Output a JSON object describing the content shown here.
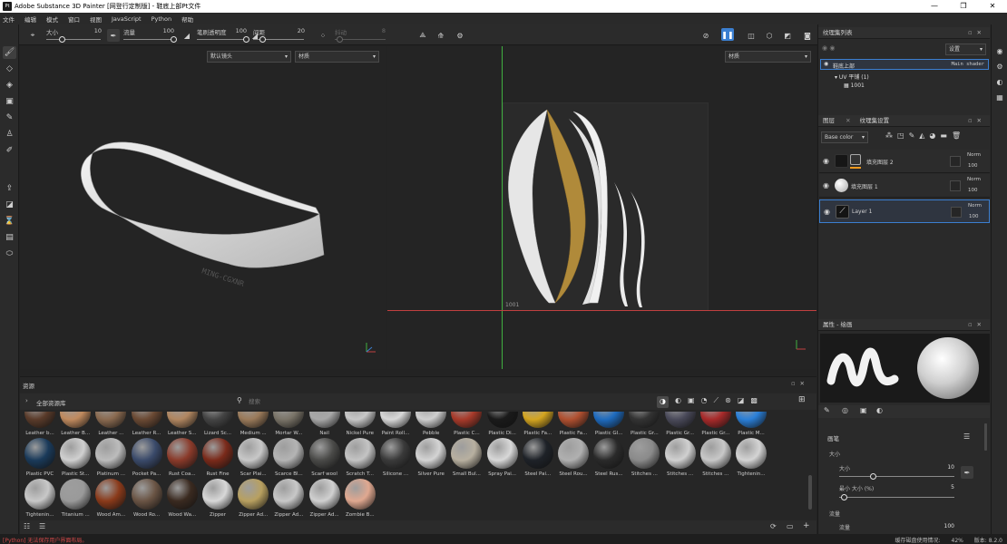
{
  "window": {
    "title": "Adobe Substance 3D Painter [网登行定制版] - 鞋底上部Pt文件",
    "logo": "Pt",
    "controls": [
      "—",
      "❐",
      "✕"
    ]
  },
  "menu": [
    "文件",
    "编辑",
    "模式",
    "窗口",
    "视图",
    "JavaScript",
    "Python",
    "帮助"
  ],
  "toolbar": {
    "size_label": "大小",
    "size_value": "10",
    "size_level": 0.3,
    "flow_label": "流量",
    "flow_value": "100",
    "flow_level": 1.0,
    "stroke_opacity_label": "笔刷透明度",
    "stroke_opacity_value": "100",
    "stroke_opacity_level": 1.0,
    "spacing_label": "间距",
    "spacing_value": "20",
    "spacing_level": 0.2,
    "jitter_label": "抖动",
    "jitter_value": "8",
    "jitter_level": 0.1
  },
  "viewport3d": {
    "camera": "默认镜头",
    "channel": "材质",
    "logo_text": "MING-CGXNR"
  },
  "viewport2d": {
    "channel": "材质",
    "uv_tile": "1001"
  },
  "texture_set_list": {
    "title": "纹理集列表",
    "settings": "设置",
    "items": [
      {
        "name": "鞋底上部",
        "shader": "Main shader"
      },
      {
        "name": "UV 平铺 (1)"
      },
      {
        "name": "1001"
      }
    ]
  },
  "layers": {
    "tab_layers": "图层",
    "tab_settings": "纹理集设置",
    "channel_select": "Base color",
    "items": [
      {
        "name": "填充图层 2",
        "blend": "Norm",
        "opacity": "100",
        "thumb": "#161616"
      },
      {
        "name": "填充图层 1",
        "blend": "Norm",
        "opacity": "100",
        "thumb": "#d8d8d8"
      },
      {
        "name": "Layer 1",
        "blend": "Norm",
        "opacity": "100",
        "thumb": "#141414"
      }
    ]
  },
  "properties": {
    "title": "属性 - 绘画",
    "section_brush": "画笔",
    "sub_size": "大小",
    "size_label": "大小",
    "size_value": "10",
    "size_level": 0.3,
    "min_size_label": "最小 大小 (%)",
    "min_size_value": "5",
    "min_size_level": 0.05,
    "section_flow": "流量",
    "flow_label": "流量",
    "flow_value": "100"
  },
  "assets": {
    "title": "资源",
    "library": "全部资源库",
    "search_placeholder": "搜索",
    "row0": [
      {
        "name": "Leather b...",
        "color": "#5a3b2a"
      },
      {
        "name": "Leather B...",
        "color": "#c08a5e"
      },
      {
        "name": "Leather ...",
        "color": "#8a6a50"
      },
      {
        "name": "Leather R...",
        "color": "#6b4a34"
      },
      {
        "name": "Leather S...",
        "color": "#b08660"
      },
      {
        "name": "Lizard Sc...",
        "color": "#444444"
      },
      {
        "name": "Medium ...",
        "color": "#9a7a5a"
      },
      {
        "name": "Mortar W...",
        "color": "#7a7468"
      },
      {
        "name": "Nail",
        "color": "#a8a8a8"
      },
      {
        "name": "Nickel Pure",
        "color": "#c8c8c8"
      },
      {
        "name": "Paint Roll...",
        "color": "#d8d8d8"
      },
      {
        "name": "Pebble",
        "color": "#cfcfcf"
      },
      {
        "name": "Plastic C...",
        "color": "#a83a2a"
      },
      {
        "name": "Plastic Di...",
        "color": "#1a1a1a"
      },
      {
        "name": "Plastic Fa...",
        "color": "#d4a520"
      },
      {
        "name": "Plastic Fa...",
        "color": "#b05030"
      },
      {
        "name": "Plastic Gl...",
        "color": "#1e6bbf"
      },
      {
        "name": "Plastic Gr...",
        "color": "#333333"
      },
      {
        "name": "Plastic Gr...",
        "color": "#4a4a5a"
      },
      {
        "name": "Plastic Gr...",
        "color": "#a82a2a"
      },
      {
        "name": "Plastic M...",
        "color": "#2a7fd8"
      }
    ],
    "row1": [
      {
        "name": "Plastic PVC",
        "color": "#1a3a5a"
      },
      {
        "name": "Plastic St...",
        "color": "#d0d0d0"
      },
      {
        "name": "Platinum ...",
        "color": "#bcbcbc"
      },
      {
        "name": "Pocket Pa...",
        "color": "#3a4a6a"
      },
      {
        "name": "Rust Coa...",
        "color": "#8a3a2a"
      },
      {
        "name": "Rust Fine",
        "color": "#7a2a1a"
      },
      {
        "name": "Scar Plai...",
        "color": "#c8c8c8"
      },
      {
        "name": "Scarce Bl...",
        "color": "#b4b4b4"
      },
      {
        "name": "Scarf wool",
        "color": "#4a4a48"
      },
      {
        "name": "Scratch T...",
        "color": "#c4c4c4"
      },
      {
        "name": "Silicone ...",
        "color": "#3a3a3a"
      },
      {
        "name": "Silver Pure",
        "color": "#d4d4d4"
      },
      {
        "name": "Small Bul...",
        "color": "#b8b0a0"
      },
      {
        "name": "Spray Pai...",
        "color": "#d8d8d8"
      },
      {
        "name": "Steel Pai...",
        "color": "#1e2228"
      },
      {
        "name": "Steel Rou...",
        "color": "#b0b0b0"
      },
      {
        "name": "Steel Rus...",
        "color": "#2a2a2a"
      },
      {
        "name": "Stitches ...",
        "color": "#8a8a8a"
      },
      {
        "name": "Stitches ...",
        "color": "#d0d0d0"
      },
      {
        "name": "Stitches ...",
        "color": "#c8c8c8"
      },
      {
        "name": "Tightenin...",
        "color": "#d4d4d4"
      }
    ],
    "row2": [
      {
        "name": "Tightenin...",
        "color": "#c8c8c8"
      },
      {
        "name": "Titanium ...",
        "color": "#9a9a9a"
      },
      {
        "name": "Wood Am...",
        "color": "#8a3a1a"
      },
      {
        "name": "Wood Ro...",
        "color": "#6a5444"
      },
      {
        "name": "Wood Wa...",
        "color": "#3a2a20"
      },
      {
        "name": "Zipper",
        "color": "#d8d8d8"
      },
      {
        "name": "Zipper Ad...",
        "color": "#b8a060"
      },
      {
        "name": "Zipper Ad...",
        "color": "#c8c8c8"
      },
      {
        "name": "Zipper Ad...",
        "color": "#d0d0d0"
      },
      {
        "name": "Zombie B...",
        "color": "#e0a890"
      }
    ]
  },
  "status": {
    "error": "[Python] 无法保存用户界面布局。",
    "cache_label": "缓存磁盘使用情况:",
    "cache_value": "42%",
    "version_label": "版本:",
    "version_value": "8.2.0"
  },
  "colors": {
    "accent": "#3b7fd1",
    "error": "#d04848",
    "badge": "#f39a1e",
    "x_axis": "#c04040",
    "y_axis": "#40b040"
  }
}
